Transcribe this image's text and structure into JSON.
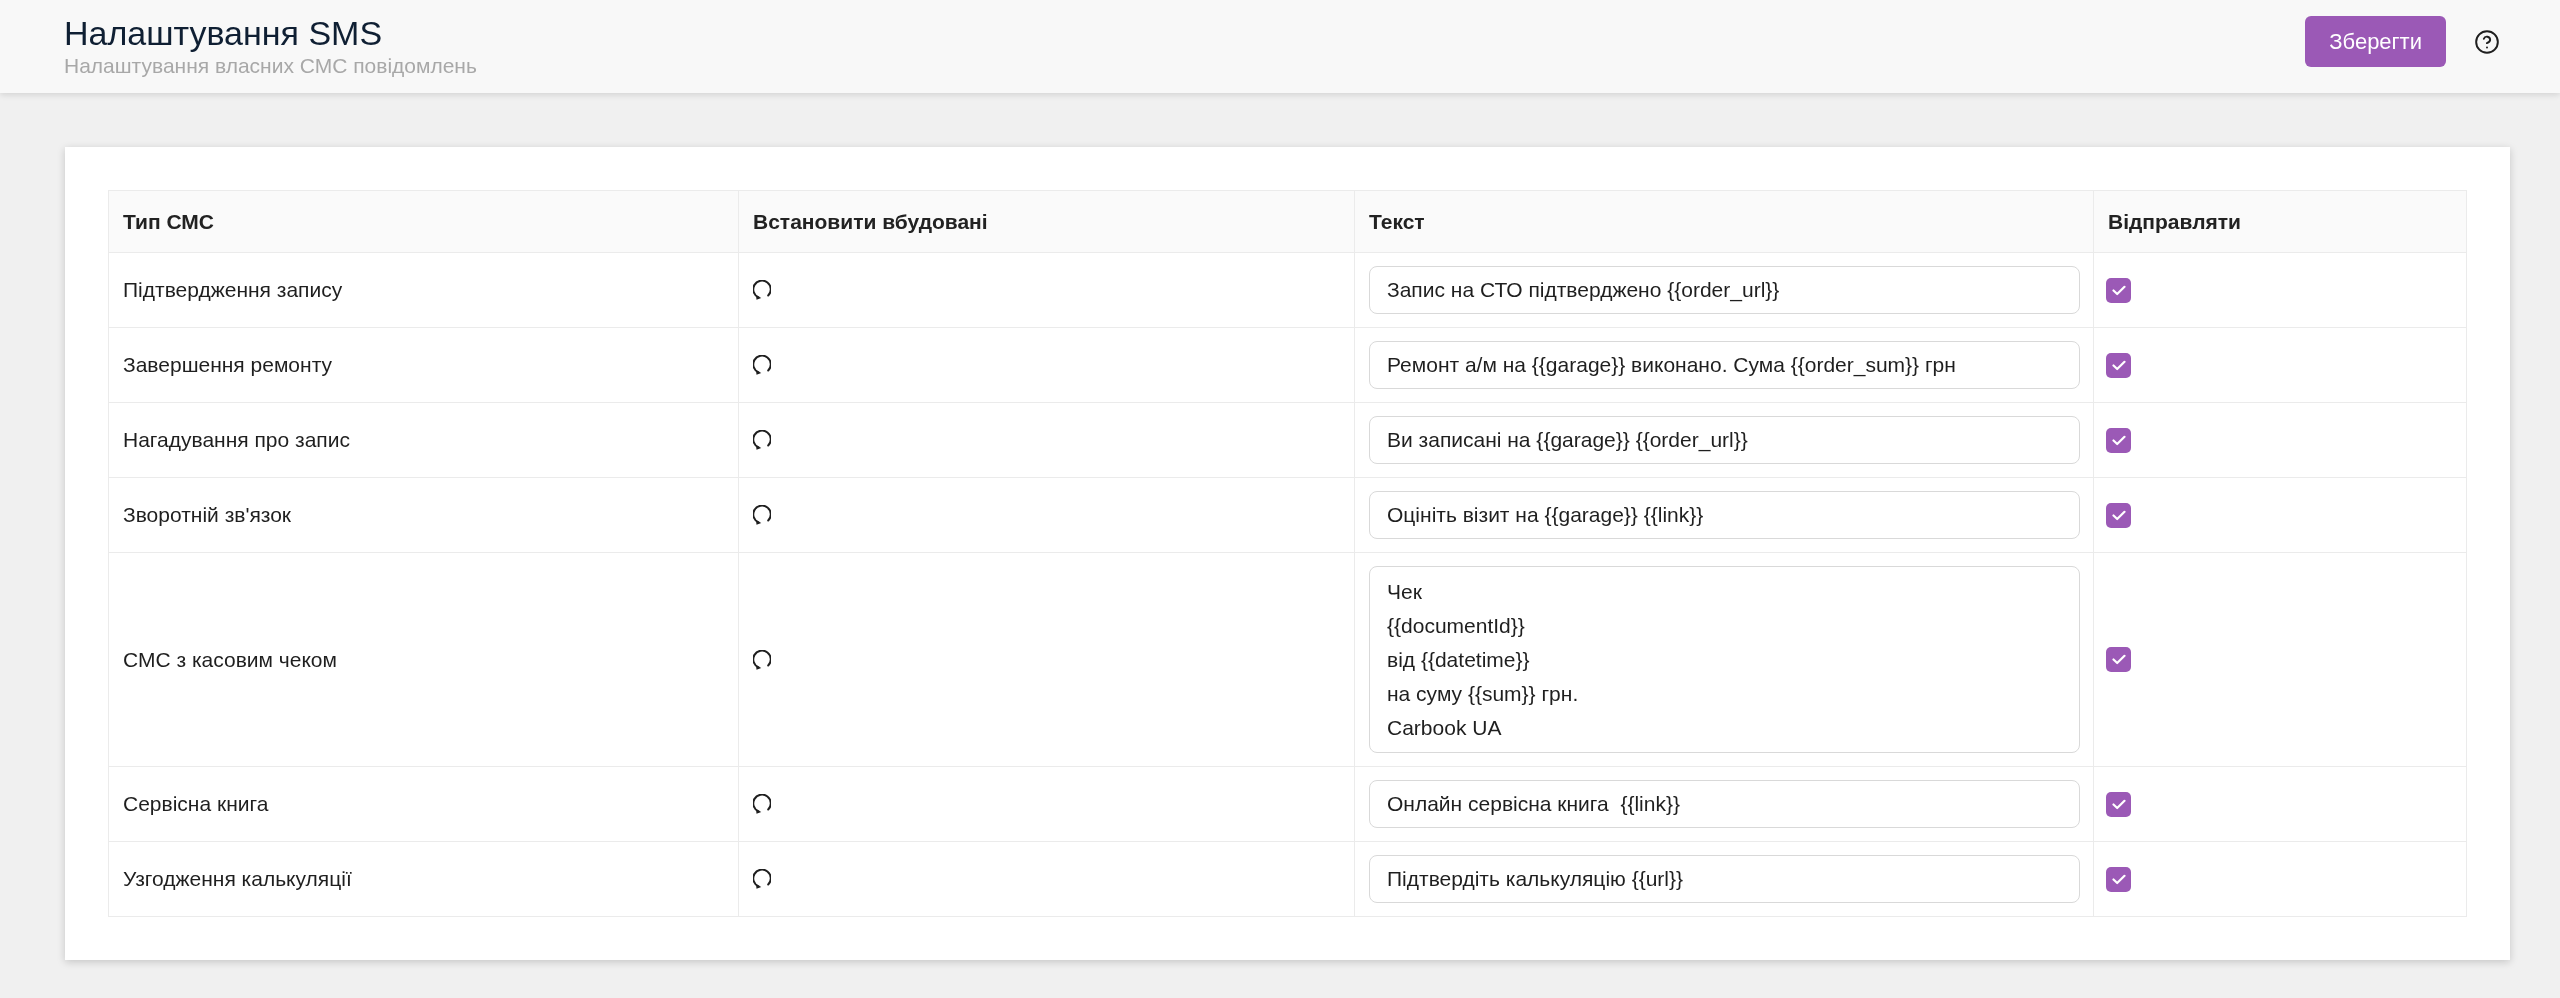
{
  "header": {
    "title": "Налаштування SMS",
    "subtitle": "Налаштування власних СМС повідомлень",
    "save_button": "Зберегти"
  },
  "table": {
    "columns": [
      "Тип СМС",
      "Встановити вбудовані",
      "Текст",
      "Відправляти"
    ],
    "rows": [
      {
        "type": "Підтвердження запису",
        "kind": "input",
        "text": "Запис на СТО підтверджено {{order_url}}",
        "send": true
      },
      {
        "type": "Завершення ремонту",
        "kind": "input",
        "text": "Ремонт а/м на {{garage}} виконано. Сума {{order_sum}} грн",
        "send": true
      },
      {
        "type": "Нагадування про запис",
        "kind": "input",
        "text": "Ви записані на {{garage}} {{order_url}}",
        "send": true
      },
      {
        "type": "Зворотній зв'язок",
        "kind": "input",
        "text": "Оцініть візит на {{garage}} {{link}}",
        "send": true
      },
      {
        "type": "СМС з касовим чеком",
        "kind": "textarea",
        "text": "Чек\n{{documentId}}\nвід {{datetime}}\nна суму {{sum}} грн.\nCarbook UA",
        "send": true
      },
      {
        "type": "Сервісна книга",
        "kind": "input",
        "text": "Онлайн сервісна книга  {{link}}",
        "send": true
      },
      {
        "type": "Узгодження калькуляції",
        "kind": "input",
        "text": "Підтвердіть калькуляцію {{url}}",
        "send": true
      }
    ]
  }
}
